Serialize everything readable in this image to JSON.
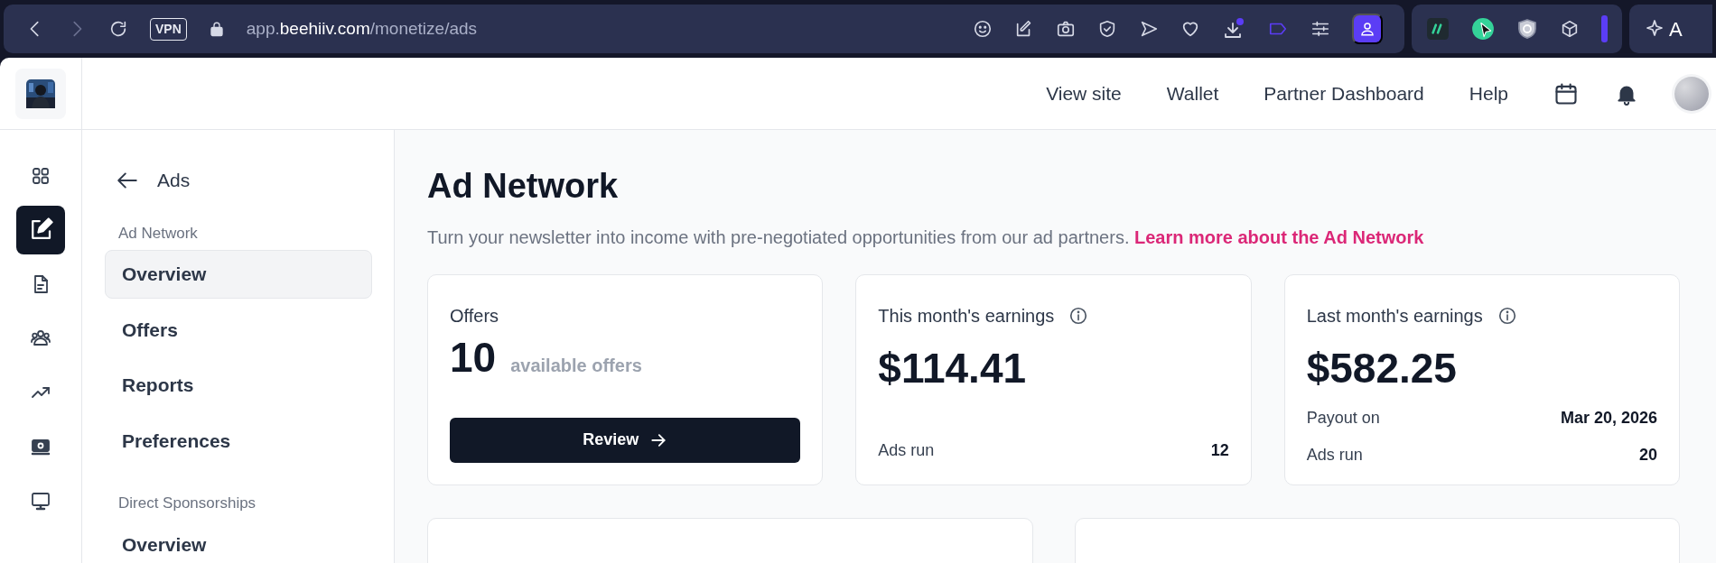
{
  "browser": {
    "vpn_badge": "VPN",
    "url_parts": [
      {
        "text": "app.",
        "emphasis": false
      },
      {
        "text": "beehiiv.com",
        "emphasis": true
      },
      {
        "text": "/monetize/ads",
        "emphasis": false
      }
    ],
    "extension_label": "A"
  },
  "header": {
    "links": [
      "View site",
      "Wallet",
      "Partner Dashboard",
      "Help"
    ]
  },
  "rail": [
    {
      "selected": false
    },
    {
      "selected": true
    },
    {
      "selected": false
    },
    {
      "selected": false
    },
    {
      "selected": false
    },
    {
      "selected": false
    },
    {
      "selected": false
    }
  ],
  "submenu": {
    "back_label": "Ads",
    "sections": [
      {
        "heading": "Ad Network",
        "items": [
          {
            "label": "Overview",
            "selected": true
          },
          {
            "label": "Offers",
            "selected": false
          },
          {
            "label": "Reports",
            "selected": false
          },
          {
            "label": "Preferences",
            "selected": false
          }
        ]
      },
      {
        "heading": "Direct Sponsorships",
        "items": [
          {
            "label": "Overview",
            "selected": false
          }
        ]
      }
    ]
  },
  "main": {
    "title": "Ad Network",
    "description": "Turn your newsletter into income with pre-negotiated opportunities from our ad partners.",
    "description_link": "Learn more about the Ad Network",
    "cards": [
      {
        "kind": "offers",
        "title": "Offers",
        "count": "10",
        "count_label": "available offers",
        "button": "Review"
      },
      {
        "kind": "earnings",
        "title": "This month's earnings",
        "amount": "$114.41",
        "rows": [
          {
            "label": "Ads run",
            "value": "12"
          }
        ]
      },
      {
        "kind": "earnings",
        "title": "Last month's earnings",
        "amount": "$582.25",
        "rows": [
          {
            "label": "Payout on",
            "value": "Mar 20, 2026"
          },
          {
            "label": "Ads run",
            "value": "20"
          }
        ]
      }
    ]
  }
}
